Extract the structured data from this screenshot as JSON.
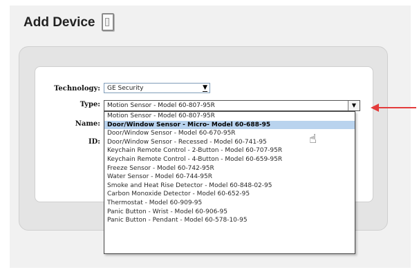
{
  "header": {
    "title": "Add Device",
    "icon": "door-sensor-icon"
  },
  "form": {
    "technology_label": "Technology:",
    "technology_value": "GE Security",
    "type_label": "Type:",
    "type_value": "Motion Sensor - Model 60-807-95R",
    "name_label": "Name:",
    "id_label": "ID:"
  },
  "type_options": [
    "Motion Sensor - Model 60-807-95R",
    "Door/Window Sensor - Micro- Model 60-688-95",
    "Door/Window Sensor - Model 60-670-95R",
    "Door/Window Sensor - Recessed - Model 60-741-95",
    "Keychain Remote Control - 2-Button - Model 60-707-95R",
    "Keychain Remote Control - 4-Button - Model 60-659-95R",
    "Freeze Sensor - Model 60-742-95R",
    "Water Sensor - Model 60-744-95R",
    "Smoke and Heat Rise Detector - Model 60-848-02-95",
    "Carbon Monoxide Detector - Model 60-652-95",
    "Thermostat - Model 60-909-95",
    "Panic Button - Wrist - Model 60-906-95",
    "Panic Button - Pendant - Model 60-578-10-95"
  ],
  "highlighted_option_index": 1,
  "annotation": {
    "arrow_color": "#e33b3b"
  },
  "colors": {
    "highlight": "#b9d3ee",
    "panel": "#e4e4e4"
  }
}
